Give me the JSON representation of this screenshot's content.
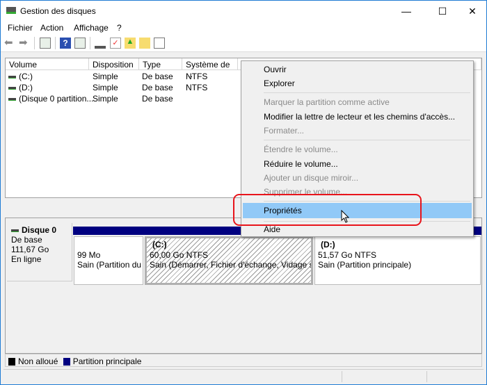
{
  "window": {
    "title": "Gestion des disques",
    "minimize": "—",
    "maximize": "☐",
    "close": "✕"
  },
  "menubar": [
    "Fichier",
    "Action",
    "Affichage",
    "?"
  ],
  "toolbar": [
    "back-icon",
    "forward-icon",
    "console-tree-icon",
    "help-icon",
    "action-pane-icon",
    "connect-icon",
    "check-icon",
    "folder-up-icon",
    "folder-search-icon",
    "list-icon"
  ],
  "table": {
    "headers": [
      "Volume",
      "Disposition",
      "Type",
      "Système de ..."
    ],
    "rows": [
      [
        "(C:)",
        "Simple",
        "De base",
        "NTFS"
      ],
      [
        "(D:)",
        "Simple",
        "De base",
        "NTFS"
      ],
      [
        "(Disque 0 partition...",
        "Simple",
        "De base",
        ""
      ]
    ]
  },
  "disk": {
    "name": "Disque 0",
    "type": "De base",
    "size": "111,67 Go",
    "state": "En ligne",
    "partitions": [
      {
        "label": "",
        "size": "99 Mo",
        "status": "Sain (Partition du"
      },
      {
        "label": "(C:)",
        "size": "60,00 Go NTFS",
        "status": "Sain (Démarrer, Fichier d'échange, Vidage sur ir"
      },
      {
        "label": "(D:)",
        "size": "51,57 Go NTFS",
        "status": "Sain (Partition principale)"
      }
    ]
  },
  "legend": [
    {
      "label": "Non alloué",
      "color": "#000000"
    },
    {
      "label": "Partition principale",
      "color": "#000080"
    }
  ],
  "context_menu": {
    "items": [
      {
        "label": "Ouvrir",
        "enabled": true
      },
      {
        "label": "Explorer",
        "enabled": true
      },
      {
        "label": "Marquer la partition comme active",
        "enabled": false
      },
      {
        "label": "Modifier la lettre de lecteur et les chemins d'accès...",
        "enabled": true
      },
      {
        "label": "Formater...",
        "enabled": false
      },
      {
        "label": "Étendre le volume...",
        "enabled": false
      },
      {
        "label": "Réduire le volume...",
        "enabled": true
      },
      {
        "label": "Ajouter un disque miroir...",
        "enabled": false
      },
      {
        "label": "Supprimer le volume...",
        "enabled": false
      },
      {
        "label": "Propriétés",
        "enabled": true,
        "highlighted": true
      },
      {
        "label": "Aide",
        "enabled": true
      }
    ]
  },
  "colors": {
    "highlight": "#91c9f7",
    "annotation": "#e8141b",
    "partition": "#000080"
  }
}
